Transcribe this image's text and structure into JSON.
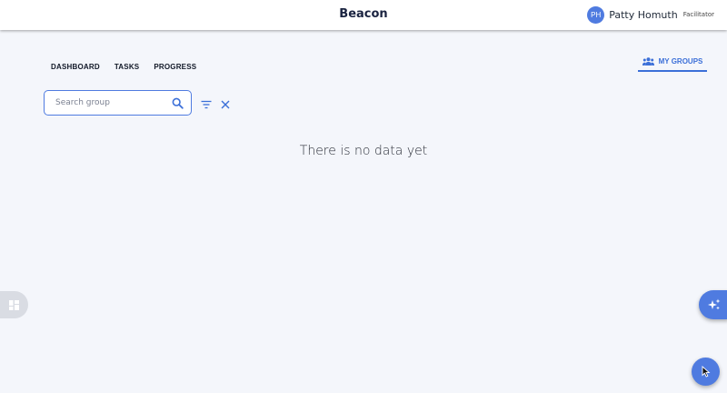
{
  "header": {
    "brand": "Beacon",
    "user": {
      "initials": "PH",
      "name": "Patty Homuth",
      "role": "Facilitator"
    }
  },
  "nav": {
    "items": [
      {
        "label": "DASHBOARD"
      },
      {
        "label": "TASKS"
      },
      {
        "label": "PROGRESS"
      }
    ],
    "my_groups_label": "MY GROUPS"
  },
  "search": {
    "placeholder": "Search group",
    "value": ""
  },
  "main": {
    "empty_message": "There is no data yet"
  },
  "icons": {
    "search": "search-icon",
    "filter": "filter-icon",
    "clear": "close-icon",
    "groups": "groups-icon",
    "widgets": "grid-icon",
    "ai": "sparkle-icon",
    "fab": "cursor-icon"
  },
  "colors": {
    "accent": "#4f7be0",
    "background": "#f4f6fb",
    "brand_text": "#1a2340"
  }
}
